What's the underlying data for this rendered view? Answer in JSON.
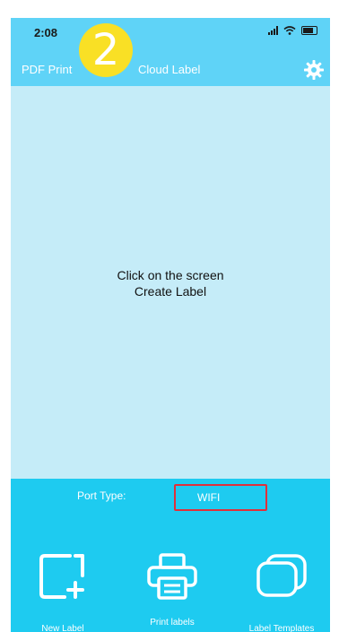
{
  "status_bar": {
    "time": "2:08"
  },
  "badge": {
    "number": "2",
    "color": "#f9e025"
  },
  "header": {
    "nav_pdf": "PDF Print",
    "nav_cloud": "Cloud Label",
    "settings_icon": "gear-icon"
  },
  "canvas": {
    "line1": "Click on the screen",
    "line2": "Create Label"
  },
  "port": {
    "label": "Port Type:",
    "value": "WIFI",
    "highlight_color": "#e0303a"
  },
  "bottom_nav": [
    {
      "icon": "new-label-icon",
      "label": "New Label"
    },
    {
      "icon": "printer-icon",
      "label": "Print labels"
    },
    {
      "icon": "templates-icon",
      "label": "Label Templates"
    }
  ],
  "colors": {
    "header_bg": "#5fd3f7",
    "canvas_bg": "#c5ecf8",
    "bottom_bg": "#1ecbf0"
  }
}
